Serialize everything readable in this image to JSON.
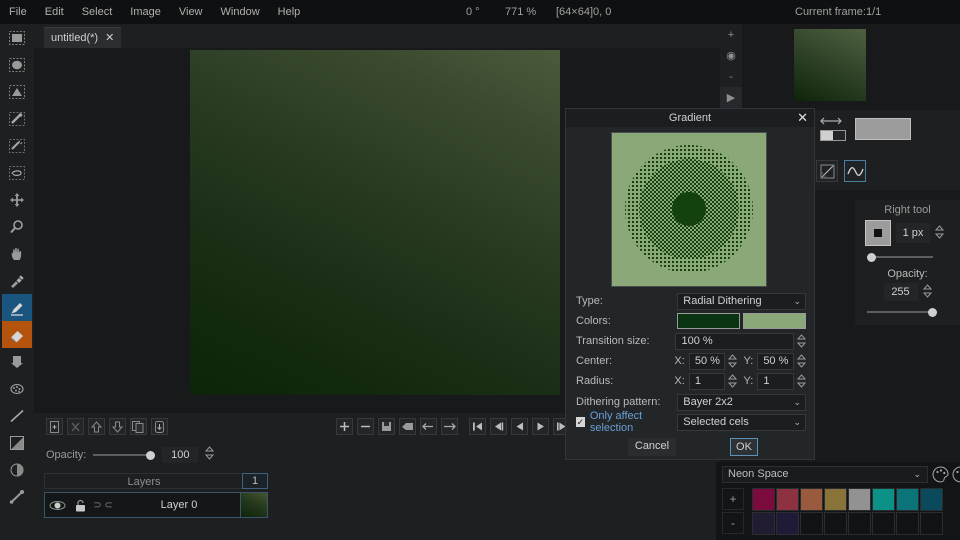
{
  "menu": {
    "items": [
      "File",
      "Edit",
      "Select",
      "Image",
      "View",
      "Window",
      "Help"
    ]
  },
  "status": {
    "rotation": "0 °",
    "zoom": "771 %",
    "size": "[64×64]",
    "cursor": "0, 0",
    "frame_label": "Current frame:",
    "frame_value": "1/1"
  },
  "tab": {
    "label": "untitled(*)",
    "close": "✕"
  },
  "tools": [
    {
      "name": "rectangular-marquee-icon"
    },
    {
      "name": "elliptical-marquee-icon"
    },
    {
      "name": "polygonal-marquee-icon"
    },
    {
      "name": "magic-wand-icon"
    },
    {
      "name": "lasso-icon"
    },
    {
      "name": "contour-icon"
    },
    {
      "name": "move-icon"
    },
    {
      "name": "zoom-icon"
    },
    {
      "name": "hand-icon"
    },
    {
      "name": "eyedropper-icon"
    },
    {
      "name": "pencil-icon"
    },
    {
      "name": "eraser-icon"
    },
    {
      "name": "paint-bucket-icon"
    },
    {
      "name": "spray-icon"
    },
    {
      "name": "line-icon"
    },
    {
      "name": "gradient-icon"
    },
    {
      "name": "shading-icon"
    },
    {
      "name": "blur-icon"
    }
  ],
  "frames": {
    "new_frame": "+",
    "remove_frame": "−",
    "playback": [
      "first",
      "prev-frame",
      "prev",
      "play",
      "last"
    ],
    "opacity_label": "Opacity:",
    "opacity_value": "100"
  },
  "layers": {
    "header": "Layers",
    "frame_number": "1",
    "rows": [
      {
        "name": "Layer 0"
      }
    ]
  },
  "preview": {
    "zoom_in": "+",
    "zoom_reset": "◉",
    "zoom_out": "-",
    "play": "▶"
  },
  "right_tool": {
    "title": "Right tool",
    "brush_size": "1 px",
    "opacity_label": "Opacity:",
    "opacity_value": "255"
  },
  "palette": {
    "name": "Neon Space",
    "add_label": "+",
    "remove_label": "-",
    "colors": [
      "#7a0b3c",
      "#8c3240",
      "#9a5a3e",
      "#8a7338",
      "#929292",
      "#0c9187",
      "#0a7479",
      "#0a4a5c",
      "#221c33",
      "#1e1a38",
      "#111314",
      "#111314",
      "#111314",
      "#111314",
      "#111314",
      "#111314"
    ]
  },
  "dialog": {
    "title": "Gradient",
    "close": "✕",
    "type_label": "Type:",
    "type_value": "Radial Dithering",
    "colors_label": "Colors:",
    "color_from": "#0a3311",
    "color_to": "#8aa878",
    "transition_label": "Transition size:",
    "transition_value": "100 %",
    "center_label": "Center:",
    "center_x_label": "X:",
    "center_x": "50 %",
    "center_y_label": "Y:",
    "center_y": "50 %",
    "radius_label": "Radius:",
    "radius_x_label": "X:",
    "radius_x": "1",
    "radius_y_label": "Y:",
    "radius_y": "1",
    "dither_label": "Dithering pattern:",
    "dither_value": "Bayer 2x2",
    "only_selection_label": "Only affect selection",
    "only_selection_checked": "✓",
    "target_value": "Selected cels",
    "cancel": "Cancel",
    "ok": "OK",
    "chevron": "⌄"
  }
}
